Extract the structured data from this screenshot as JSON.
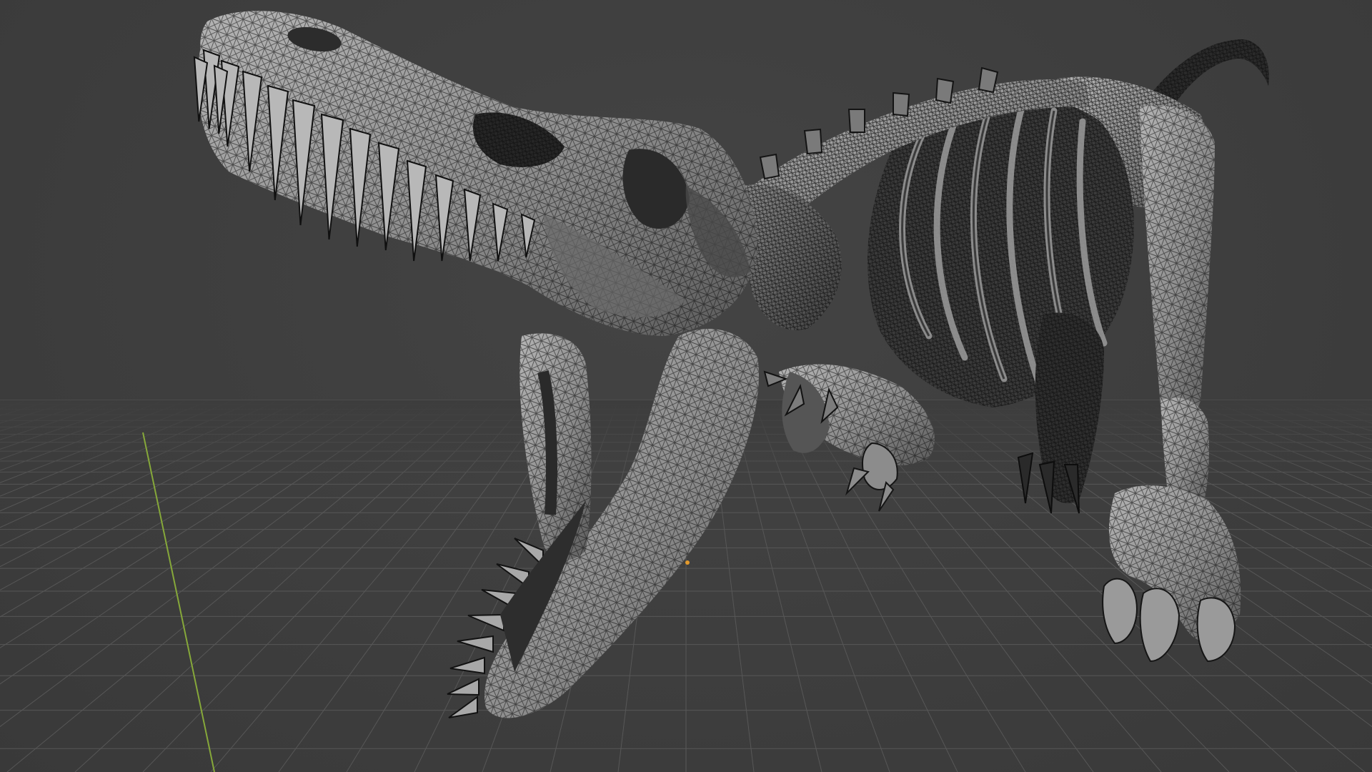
{
  "app": {
    "name": "3D viewport",
    "object": "dinosaur-skeleton-mesh"
  },
  "viewport": {
    "background_color": "#3d3d3d",
    "grid_color": "#585858",
    "y_axis_color": "#86a83a",
    "origin_color": "#e39a2d",
    "mesh_fill_color": "#8e8e8e",
    "wire_color": "#111111",
    "shading": "wireframe-overlay",
    "visible_text": []
  }
}
